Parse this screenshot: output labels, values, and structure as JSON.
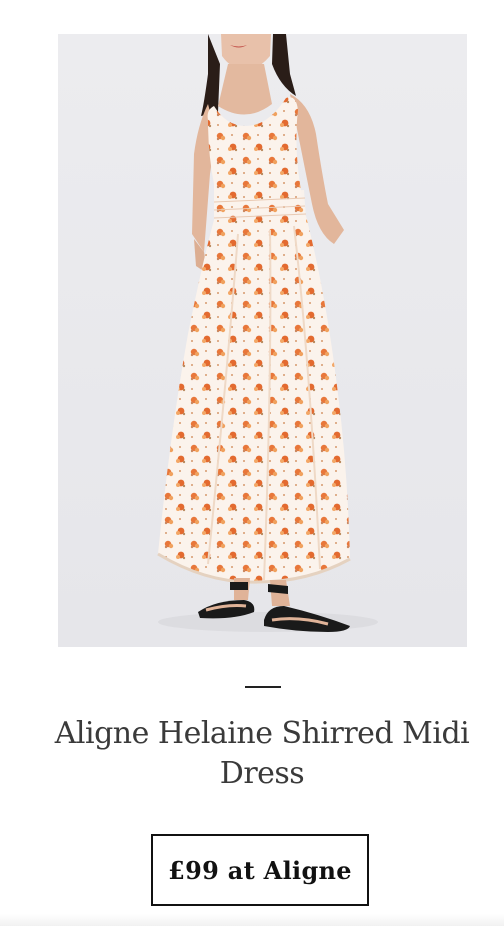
{
  "product": {
    "image_alt": "Aligne Helaine Shirred Midi Dress",
    "title": "Aligne Helaine Shirred Midi Dress",
    "cta_label": "£99 at Aligne"
  },
  "colors": {
    "image_background": "#ebebed",
    "dress_base": "#fbf3ec",
    "floral_print": "#e8773a",
    "text": "#3a3a3a",
    "button_border": "#111111"
  },
  "icons": {
    "divider": "horizontal-rule"
  }
}
